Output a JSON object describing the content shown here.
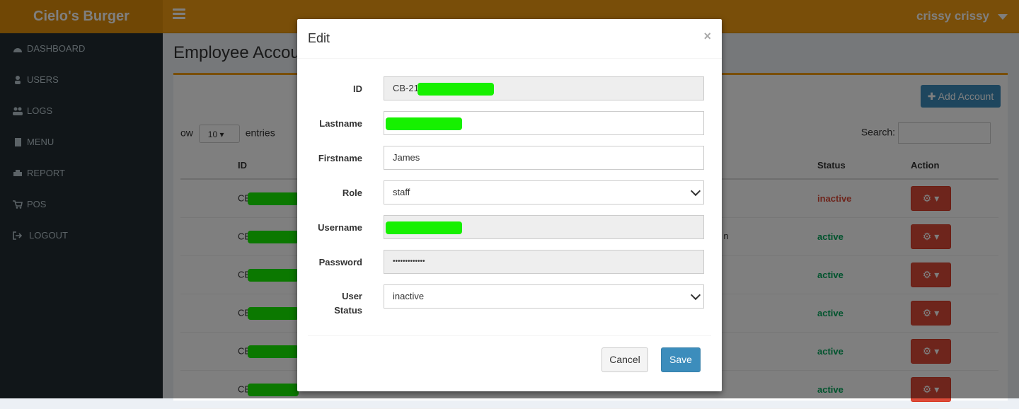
{
  "brand": "Cielo's Burger",
  "user_name": "crissy crissy",
  "sidebar": {
    "items": [
      {
        "label": "DASHBOARD",
        "icon": "dashboard-icon"
      },
      {
        "label": "USERS",
        "icon": "user-icon"
      },
      {
        "label": "LOGS",
        "icon": "users-icon"
      },
      {
        "label": "MENU",
        "icon": "file-icon"
      },
      {
        "label": "REPORT",
        "icon": "print-icon"
      },
      {
        "label": "POS",
        "icon": "cart-icon"
      },
      {
        "label": "LOGOUT",
        "icon": "sign-out-icon"
      }
    ]
  },
  "page": {
    "title": "Employee Accoun",
    "add_button": "Add Account",
    "show_prefix": "ow",
    "show_value": "10",
    "show_suffix": "entries",
    "search_label": "Search:"
  },
  "table": {
    "headers": [
      "ID",
      "Status",
      "Action"
    ],
    "rows": [
      {
        "id_prefix": "CB-",
        "status": "inactive"
      },
      {
        "id_prefix": "CB-",
        "status": "active",
        "partial": "n"
      },
      {
        "id_prefix": "CB-",
        "status": "active"
      },
      {
        "id_prefix": "CB-",
        "status": "active"
      },
      {
        "id_prefix": "CB-",
        "status": "active"
      },
      {
        "id_prefix": "CB-",
        "status": "active"
      }
    ]
  },
  "modal": {
    "title": "Edit",
    "close": "×",
    "fields": {
      "id_label": "ID",
      "id_value": "CB-21",
      "lastname_label": "Lastname",
      "firstname_label": "Firstname",
      "firstname_value": "James",
      "role_label": "Role",
      "role_value": "staff",
      "username_label": "Username",
      "password_label": "Password",
      "password_value": "•••••••••••••",
      "status_label_1": "User",
      "status_label_2": "Status",
      "status_value": "inactive"
    },
    "cancel": "Cancel",
    "save": "Save"
  },
  "colors": {
    "header": "#f39c12",
    "sidebar": "#222d32",
    "primary": "#3c8dbc",
    "danger": "#dd4b39",
    "success": "#00a65a",
    "redaction": "#16f000"
  }
}
